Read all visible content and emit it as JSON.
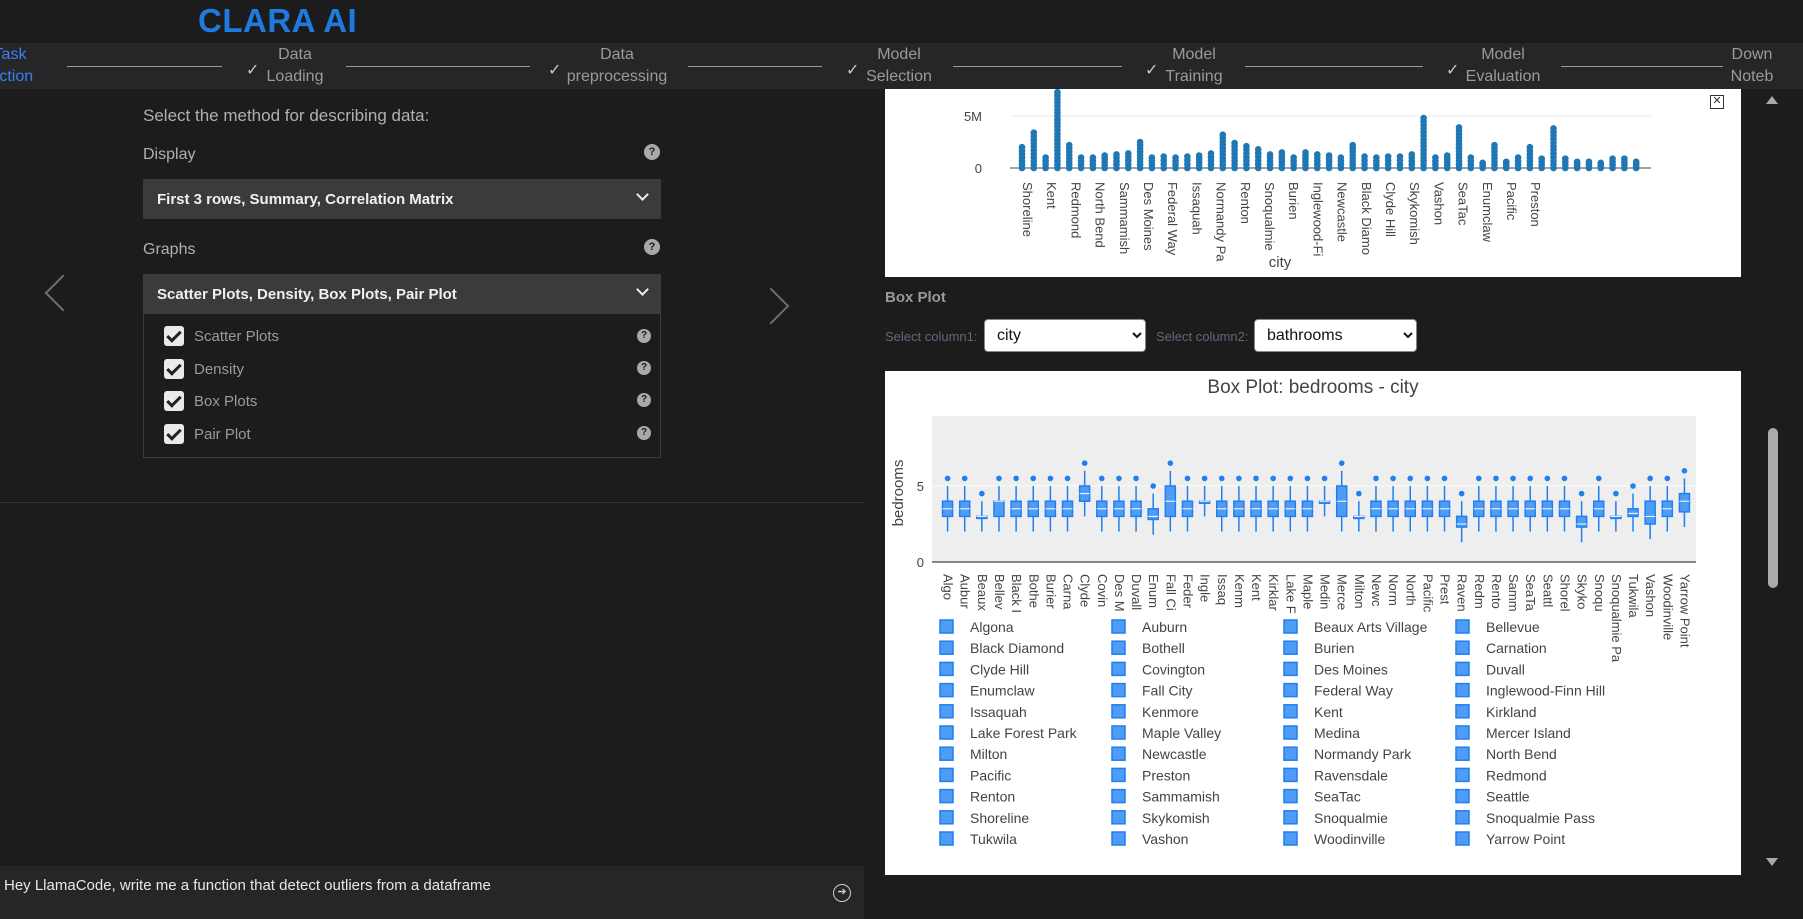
{
  "app": {
    "brand": "CLARA AI"
  },
  "steps": [
    {
      "label": "Task\nSelection",
      "shown": "Task\nlection"
    },
    {
      "label": "Data\nLoading"
    },
    {
      "label": "Data\npreprocessing"
    },
    {
      "label": "Model\nSelection"
    },
    {
      "label": "Model\nTraining"
    },
    {
      "label": "Model\nEvaluation"
    },
    {
      "label": "Down\nNoteb"
    }
  ],
  "left": {
    "method_heading": "Select the method for describing data:",
    "display_label": "Display",
    "display_value": "First 3 rows, Summary, Correlation Matrix",
    "graphs_label": "Graphs",
    "graphs_value": "Scatter Plots, Density, Box Plots, Pair Plot",
    "graph_options": [
      "Scatter Plots",
      "Density",
      "Box Plots",
      "Pair Plot"
    ],
    "help_glyph": "?"
  },
  "chat": {
    "value": "Hey LlamaCode, write me a function that detect outliers from a dataframe"
  },
  "boxplot_section": {
    "title": "Box Plot",
    "select1_label": "Select column1:",
    "select1_value": "city",
    "select2_label": "Select column2:",
    "select2_value": "bathrooms"
  },
  "colors": {
    "accent": "#1f7ae0",
    "plot_blue": "#1f77b4",
    "box_blue": "#1f7ff0"
  },
  "chart_data": [
    {
      "type": "scatter",
      "title": "",
      "xlabel": "city",
      "ylabel": "",
      "yticks": [
        "0",
        "5M"
      ],
      "tick_labels": [
        "Shoreline",
        "Kent",
        "Redmond",
        "North Bend",
        "Sammamish",
        "Des Moines",
        "Federal Way",
        "Issaquah",
        "Normandy Pa",
        "Renton",
        "Snoqualmie",
        "Burien",
        "Inglewood-Fi",
        "Newcastle",
        "Black Diamo",
        "Clyde Hill",
        "Skykomish",
        "Vashon",
        "SeaTac",
        "Enumclaw",
        "Pacific",
        "Preston"
      ],
      "max_values": [
        2.0,
        3.4,
        1.0,
        7.3,
        2.2,
        1.0,
        1.0,
        1.2,
        1.3,
        1.4,
        2.5,
        1.0,
        1.1,
        1.0,
        1.1,
        1.2,
        1.4,
        3.2,
        2.4,
        2.1,
        1.8,
        1.3,
        1.5,
        1.0,
        1.5,
        1.3,
        1.2,
        1.0,
        2.2,
        1.1,
        1.0,
        1.1,
        1.1,
        1.3,
        4.8,
        1.0,
        1.2,
        3.9,
        1.0,
        0.5,
        2.2,
        0.6,
        1.0,
        2.0,
        0.9,
        3.8,
        0.9,
        0.6,
        0.6,
        0.5,
        0.9,
        0.9,
        0.6
      ]
    },
    {
      "type": "box",
      "title": "Box Plot: bedrooms - city",
      "ylabel": "bedrooms",
      "yticks": [
        "0",
        "5"
      ],
      "categories": [
        "Algona",
        "Auburn",
        "Beaux Arts Village",
        "Bellevue",
        "Black Diamond",
        "Bothell",
        "Burien",
        "Carnation",
        "Clyde Hill",
        "Covington",
        "Des Moines",
        "Duvall",
        "Enumclaw",
        "Fall City",
        "Federal Way",
        "Inglewood-Finn Hill",
        "Issaquah",
        "Kenmore",
        "Kent",
        "Kirkland",
        "Lake Forest Park",
        "Maple Valley",
        "Medina",
        "Mercer Island",
        "Milton",
        "Newcastle",
        "Normandy Park",
        "North Bend",
        "Pacific",
        "Preston",
        "Ravensdale",
        "Redmond",
        "Renton",
        "Sammamish",
        "SeaTac",
        "Seattle",
        "Shoreline",
        "Skykomish",
        "Snoqualmie",
        "Snoqualmie Pass",
        "Tukwila",
        "Vashon",
        "Woodinville",
        "Yarrow Point"
      ],
      "tick_labels": [
        "Algo",
        "Aubur",
        "Beaux",
        "Bellev",
        "Black I",
        "Bothe",
        "Burier",
        "Carna",
        "Clyde",
        "Covin",
        "Des M",
        "Duvall",
        "Enum",
        "Fall Ci",
        "Feder",
        "Ingle",
        "Issaq",
        "Kenm",
        "Kent",
        "Kirklar",
        "Lake F",
        "Maple",
        "Medin",
        "Merce",
        "Milton",
        "Newc",
        "Norm",
        "North",
        "Pacific",
        "Prest",
        "Raven",
        "Redm",
        "Rento",
        "Samm",
        "SeaTa",
        "Seattl",
        "Shorel",
        "Skyko",
        "Snoqu",
        "Snoqualmie Pa",
        "Tukwila",
        "Vashon",
        "Woodinville",
        "Yarrow Point"
      ],
      "q1": [
        3,
        3,
        3,
        3,
        3,
        3,
        3,
        3,
        4,
        3,
        3,
        3,
        2.8,
        3,
        3,
        4,
        3,
        3,
        3,
        3,
        3,
        3,
        4,
        3,
        3,
        3,
        3,
        3,
        3,
        3,
        2.3,
        3,
        3,
        3,
        3,
        3,
        3,
        2.3,
        3,
        3,
        3,
        2.5,
        3,
        3.3
      ],
      "median": [
        3.5,
        3.5,
        3,
        4,
        3.5,
        3.5,
        3.5,
        3.5,
        4.5,
        3.5,
        3.5,
        3.5,
        3,
        4,
        3.5,
        4,
        3.5,
        3.5,
        3.5,
        3.5,
        3.5,
        3.5,
        4,
        4,
        3,
        3.5,
        3.5,
        3.5,
        3.5,
        3.5,
        2.5,
        3.5,
        3.5,
        3.5,
        3.5,
        3.5,
        3.5,
        2.5,
        3.5,
        3,
        3.2,
        3,
        3.5,
        4
      ],
      "q3": [
        4,
        4,
        3,
        4,
        4,
        4,
        4,
        4,
        5,
        4,
        4,
        4,
        3.5,
        5,
        4,
        4,
        4,
        4,
        4,
        4,
        4,
        4,
        4,
        5,
        3,
        4,
        4,
        4,
        4,
        4,
        3,
        4,
        4,
        4,
        4,
        4,
        4,
        3,
        4,
        3,
        3.5,
        4,
        4,
        4.5
      ]
    }
  ],
  "legend": [
    [
      "Algona",
      "Auburn",
      "Beaux Arts Village",
      "Bellevue"
    ],
    [
      "Black Diamond",
      "Bothell",
      "Burien",
      "Carnation"
    ],
    [
      "Clyde Hill",
      "Covington",
      "Des Moines",
      "Duvall"
    ],
    [
      "Enumclaw",
      "Fall City",
      "Federal Way",
      "Inglewood-Finn Hill"
    ],
    [
      "Issaquah",
      "Kenmore",
      "Kent",
      "Kirkland"
    ],
    [
      "Lake Forest Park",
      "Maple Valley",
      "Medina",
      "Mercer Island"
    ],
    [
      "Milton",
      "Newcastle",
      "Normandy Park",
      "North Bend"
    ],
    [
      "Pacific",
      "Preston",
      "Ravensdale",
      "Redmond"
    ],
    [
      "Renton",
      "Sammamish",
      "SeaTac",
      "Seattle"
    ],
    [
      "Shoreline",
      "Skykomish",
      "Snoqualmie",
      "Snoqualmie Pass"
    ],
    [
      "Tukwila",
      "Vashon",
      "Woodinville",
      "Yarrow Point"
    ]
  ]
}
